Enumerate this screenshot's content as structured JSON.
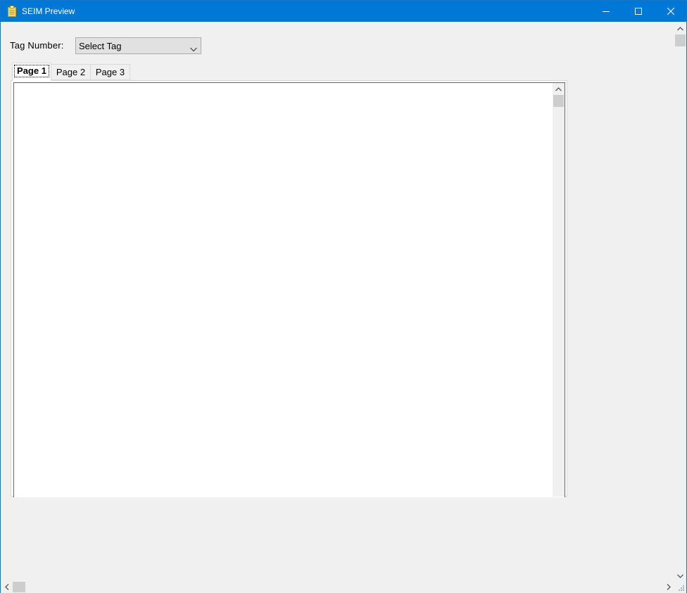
{
  "window": {
    "title": "SEIM Preview",
    "icon": "clipboard-icon",
    "accent_color": "#0078d7"
  },
  "form": {
    "tag_label": "Tag Number:",
    "tag_select_value": "Select Tag"
  },
  "tabs": [
    {
      "label": "Page 1",
      "selected": true
    },
    {
      "label": "Page 2",
      "selected": false
    },
    {
      "label": "Page 3",
      "selected": false
    }
  ]
}
